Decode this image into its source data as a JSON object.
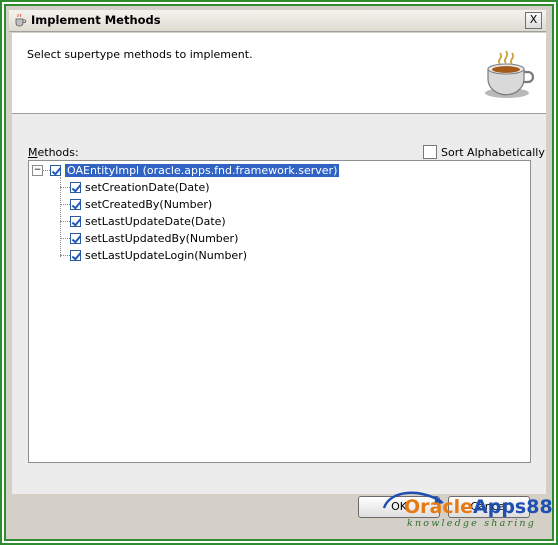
{
  "window": {
    "title": "Implement Methods",
    "close_glyph": "X",
    "header_description": "Select supertype methods to implement."
  },
  "methods": {
    "label_prefix": "M",
    "label_rest": "ethods:",
    "sort_label": "Sort Alphabetically",
    "sort_checked": false,
    "root": {
      "label": "OAEntityImpl (oracle.apps.fnd.framework.server)",
      "checked": true,
      "expanded": true
    },
    "items": [
      {
        "label": "setCreationDate(Date)",
        "checked": true
      },
      {
        "label": "setCreatedBy(Number)",
        "checked": true
      },
      {
        "label": "setLastUpdateDate(Date)",
        "checked": true
      },
      {
        "label": "setLastUpdatedBy(Number)",
        "checked": true
      },
      {
        "label": "setLastUpdateLogin(Number)",
        "checked": true
      }
    ]
  },
  "buttons": {
    "ok": "OK",
    "cancel": "Cancel"
  },
  "watermark": {
    "brand_a": "Oracle",
    "brand_b": "Apps88",
    "tagline": "knowledge sharing"
  },
  "colors": {
    "frame": "#2e8b2e",
    "selection": "#3163c5",
    "checkmark": "#2257b8",
    "brand_orange": "#e67a12",
    "brand_blue": "#1f4fb0"
  }
}
